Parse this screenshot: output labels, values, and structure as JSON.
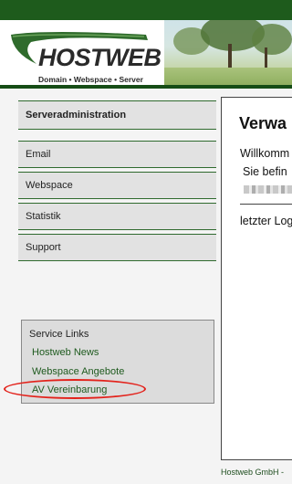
{
  "brand": {
    "name": "HOSTWEB",
    "tagline": "Domain • Webspace • Server",
    "colors": {
      "primary_green": "#1e5b1c",
      "highlight_red": "#e3221b"
    }
  },
  "sidebar": {
    "header": "Serveradministration",
    "items": [
      {
        "label": "Email"
      },
      {
        "label": "Webspace"
      },
      {
        "label": "Statistik"
      },
      {
        "label": "Support"
      }
    ]
  },
  "service_links": {
    "title": "Service Links",
    "links": [
      {
        "label": "Hostweb News"
      },
      {
        "label": "Webspace Angebote"
      },
      {
        "label": "AV Vereinbarung"
      }
    ]
  },
  "content": {
    "title": "Verwa",
    "welcome": "Willkomm",
    "location": "Sie befin",
    "last_login": "letzter Log"
  },
  "footer": {
    "text": "Hostweb GmbH -"
  }
}
